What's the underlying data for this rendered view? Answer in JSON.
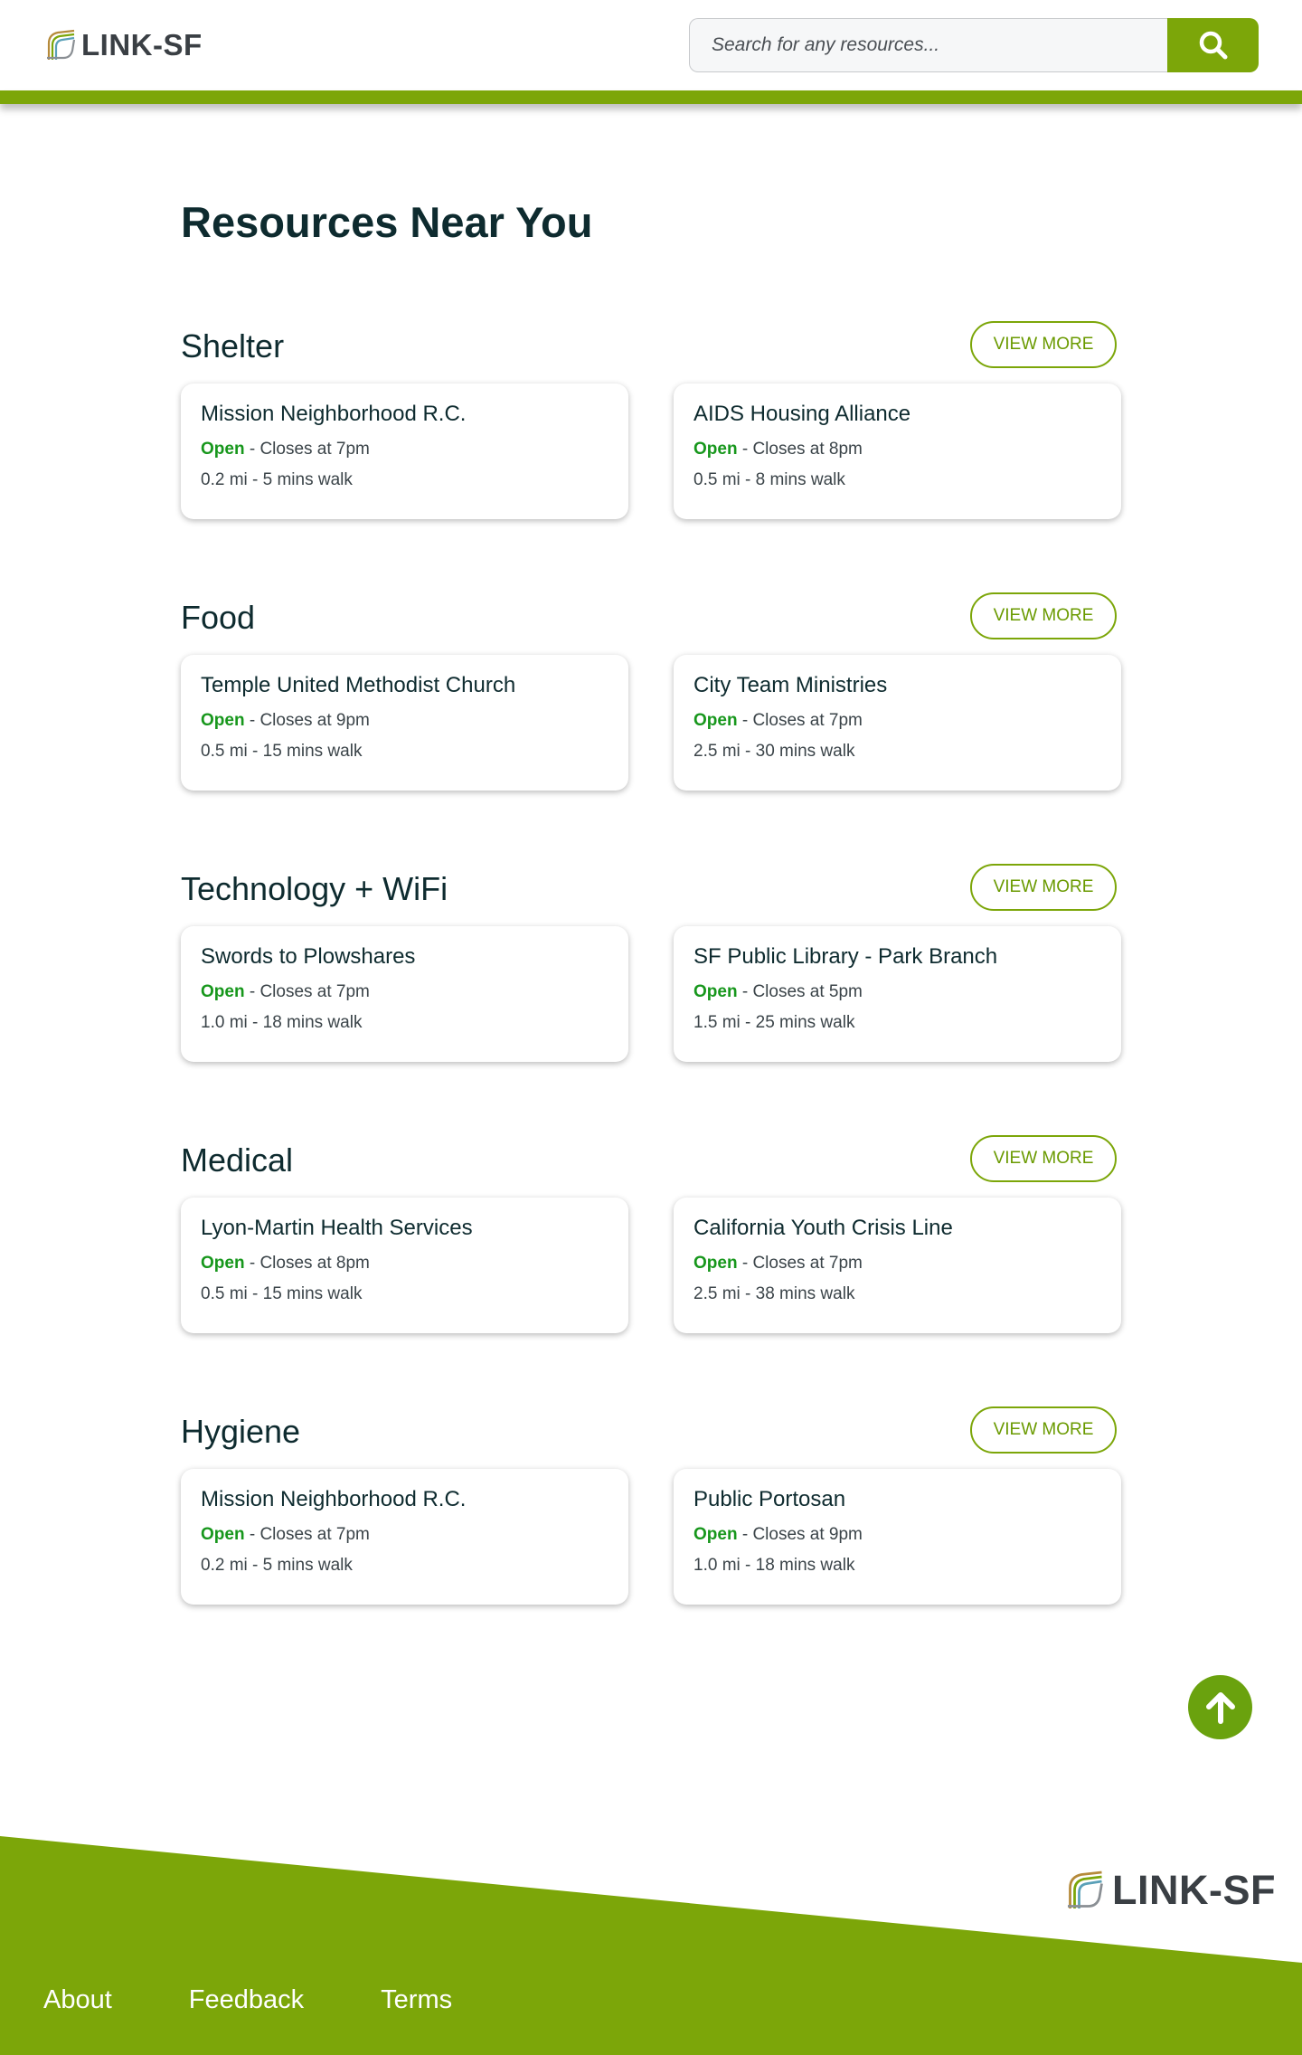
{
  "brand": {
    "logo_text": "LINK-SF"
  },
  "search": {
    "placeholder": "Search for any resources..."
  },
  "page": {
    "title": "Resources Near You"
  },
  "view_more_label": "VIEW MORE",
  "open_label": "Open",
  "sections": [
    {
      "title": "Shelter",
      "cards": [
        {
          "name": "Mission Neighborhood R.C.",
          "hours": " - Closes at 7pm",
          "distance": "0.2 mi - 5 mins walk"
        },
        {
          "name": "AIDS Housing Alliance",
          "hours": " - Closes at 8pm",
          "distance": "0.5 mi - 8 mins walk"
        }
      ]
    },
    {
      "title": "Food",
      "cards": [
        {
          "name": "Temple United Methodist Church",
          "hours": " - Closes at 9pm",
          "distance": "0.5 mi - 15 mins walk"
        },
        {
          "name": "City Team Ministries",
          "hours": " - Closes at 7pm",
          "distance": "2.5 mi - 30 mins walk"
        }
      ]
    },
    {
      "title": "Technology + WiFi",
      "cards": [
        {
          "name": "Swords to Plowshares",
          "hours": " - Closes at 7pm",
          "distance": "1.0 mi - 18 mins walk"
        },
        {
          "name": "SF Public Library - Park Branch",
          "hours": " - Closes at 5pm",
          "distance": "1.5 mi - 25 mins walk"
        }
      ]
    },
    {
      "title": "Medical",
      "cards": [
        {
          "name": "Lyon-Martin Health Services",
          "hours": " - Closes at 8pm",
          "distance": "0.5 mi - 15 mins walk"
        },
        {
          "name": "California Youth Crisis Line",
          "hours": " - Closes at 7pm",
          "distance": "2.5 mi - 38 mins walk"
        }
      ]
    },
    {
      "title": "Hygiene",
      "cards": [
        {
          "name": "Mission Neighborhood R.C.",
          "hours": " - Closes at 7pm",
          "distance": "0.2 mi - 5 mins walk"
        },
        {
          "name": "Public Portosan",
          "hours": " - Closes at 9pm",
          "distance": "1.0  mi - 18 mins walk"
        }
      ]
    }
  ],
  "footer": {
    "links": [
      {
        "label": "About"
      },
      {
        "label": "Feedback"
      },
      {
        "label": "Terms"
      }
    ]
  },
  "colors": {
    "accent": "#7ca609",
    "open_status": "#17971c",
    "heading": "#0e2b2f"
  },
  "icons": {
    "search": "search-icon",
    "back_to_top": "arrow-up-icon",
    "logo": "link-sf-logo-icon"
  }
}
